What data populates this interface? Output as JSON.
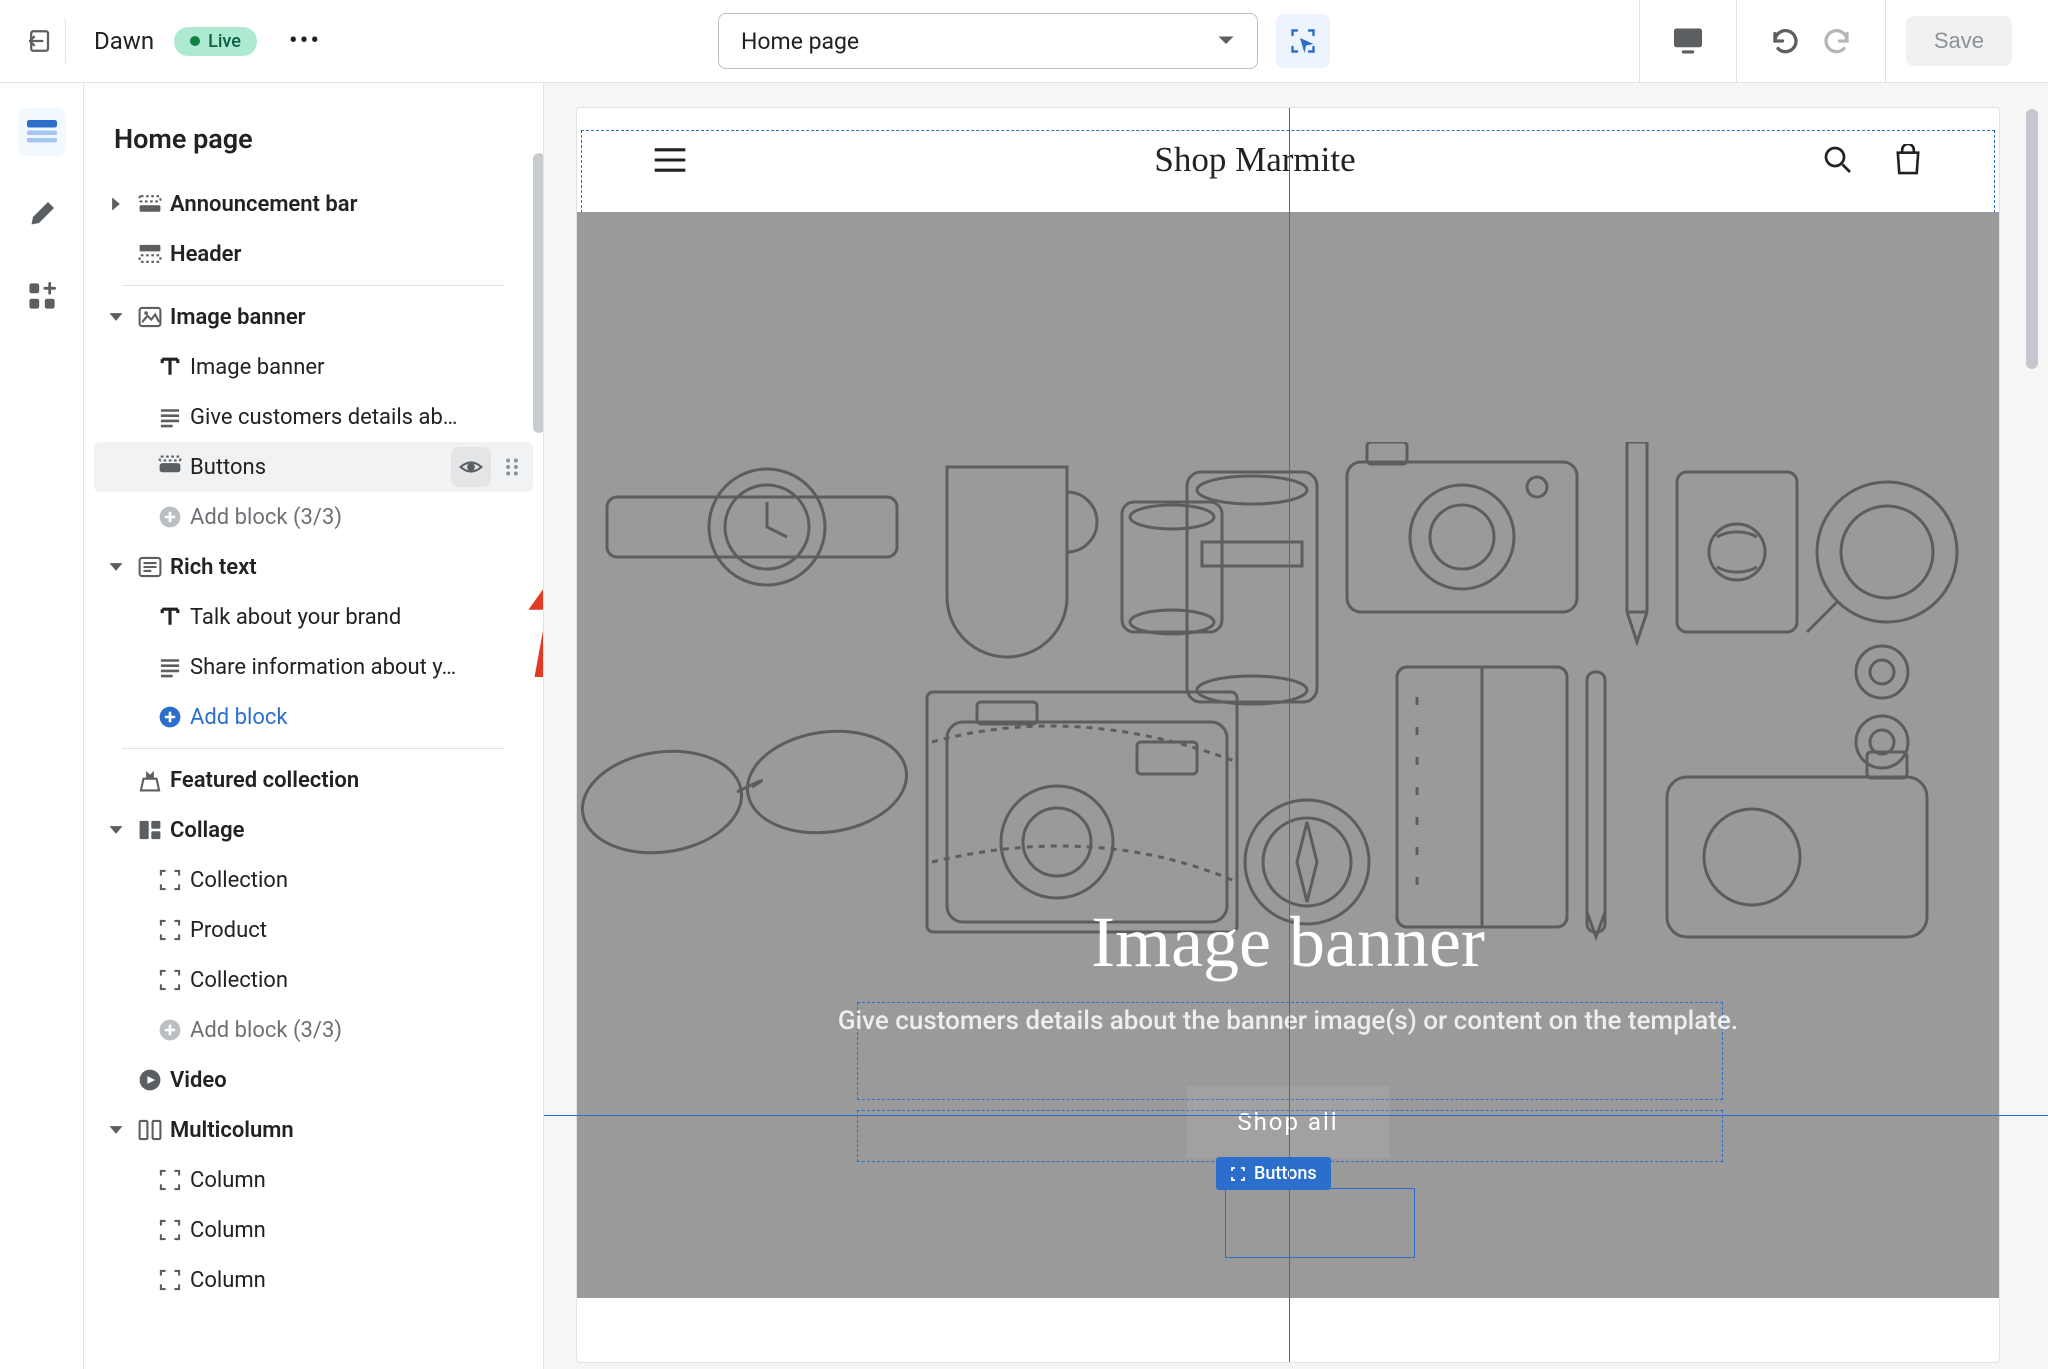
{
  "topbar": {
    "theme_name": "Dawn",
    "status_badge": "Live",
    "page_select": "Home page",
    "save_label": "Save"
  },
  "panel": {
    "title": "Home page"
  },
  "tree": {
    "sections": [
      {
        "label": "Announcement bar",
        "slug": "announcement-bar",
        "collapsed": true
      },
      {
        "label": "Header",
        "slug": "header",
        "no_caret": true
      },
      {
        "label": "Image banner",
        "slug": "image-banner",
        "children": [
          {
            "label": "Image banner",
            "icon": "text-t"
          },
          {
            "label": "Give customers details ab…",
            "icon": "paragraph"
          },
          {
            "label": "Buttons",
            "icon": "button",
            "selected": true,
            "eye": true,
            "drag": true
          }
        ],
        "add": "Add block (3/3)",
        "add_disabled": true
      },
      {
        "label": "Rich text",
        "slug": "rich-text",
        "children": [
          {
            "label": "Talk about your brand",
            "icon": "text-t"
          },
          {
            "label": "Share information about y…",
            "icon": "paragraph"
          }
        ],
        "add": "Add block",
        "add_disabled": false
      },
      {
        "label": "Featured collection",
        "slug": "featured-collection",
        "no_caret": true
      },
      {
        "label": "Collage",
        "slug": "collage",
        "children": [
          {
            "label": "Collection",
            "icon": "frame"
          },
          {
            "label": "Product",
            "icon": "frame"
          },
          {
            "label": "Collection",
            "icon": "frame"
          }
        ],
        "add": "Add block (3/3)",
        "add_disabled": true
      },
      {
        "label": "Video",
        "slug": "video",
        "no_caret": true
      },
      {
        "label": "Multicolumn",
        "slug": "multicolumn",
        "children": [
          {
            "label": "Column",
            "icon": "frame"
          },
          {
            "label": "Column",
            "icon": "frame"
          },
          {
            "label": "Column",
            "icon": "frame"
          }
        ]
      }
    ]
  },
  "preview": {
    "shop_name": "Shop Marmite",
    "banner_heading": "Image banner",
    "banner_text": "Give customers details about the banner image(s) or content on the template.",
    "banner_button": "Shop all",
    "selected_tag": "Buttons"
  }
}
